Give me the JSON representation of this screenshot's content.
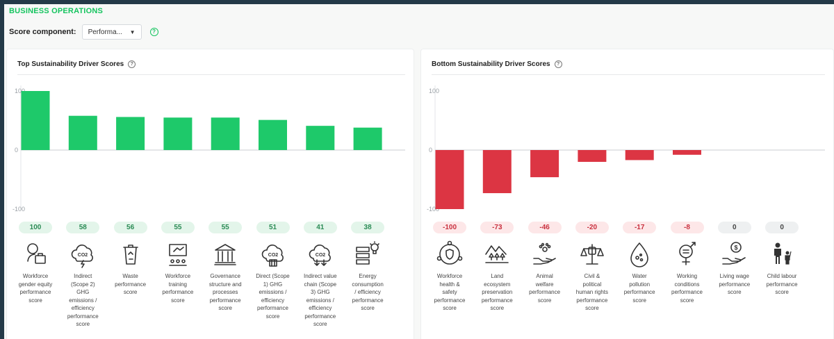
{
  "header": {
    "title": "BUSINESS OPERATIONS",
    "score_component_label": "Score component:",
    "score_component_value": "Performa...",
    "help_glyph": "?"
  },
  "colors": {
    "accent": "#14c45e",
    "positive": "#1ec96a",
    "negative": "#dc3543"
  },
  "chart_data": [
    {
      "type": "bar",
      "title": "Top Sustainability Driver Scores",
      "ylim": [
        -100,
        100
      ],
      "yticks": [
        100,
        0,
        -100
      ],
      "categories": [
        "Workforce gender equity performance score",
        "Indirect (Scope 2) GHG emissions / efficiency performance score",
        "Waste performance score",
        "Workforce training performance score",
        "Governance structure and processes performance score",
        "Direct (Scope 1) GHG emissions / efficiency performance score",
        "Indirect value chain (Scope 3) GHG emissions / efficiency performance score",
        "Energy consumption / efficiency performance score"
      ],
      "category_lines": [
        [
          "Workforce",
          "gender equity",
          "performance",
          "score"
        ],
        [
          "Indirect",
          "(Scope 2)",
          "GHG",
          "emissions /",
          "efficiency",
          "performance",
          "score"
        ],
        [
          "Waste",
          "performance",
          "score"
        ],
        [
          "Workforce",
          "training",
          "performance",
          "score"
        ],
        [
          "Governance",
          "structure and",
          "processes",
          "performance",
          "score"
        ],
        [
          "Direct (Scope",
          "1) GHG",
          "emissions /",
          "efficiency",
          "performance",
          "score"
        ],
        [
          "Indirect value",
          "chain (Scope",
          "3) GHG",
          "emissions /",
          "efficiency",
          "performance",
          "score"
        ],
        [
          "Energy",
          "consumption",
          "/ efficiency",
          "performance",
          "score"
        ]
      ],
      "icons": [
        "gender-equity-icon",
        "co2-cloud-lightning-icon",
        "recycle-bin-icon",
        "training-presentation-icon",
        "governance-building-icon",
        "co2-cloud-factory-icon",
        "co2-cloud-arrows-icon",
        "energy-battery-bulb-icon"
      ],
      "values": [
        100,
        58,
        56,
        55,
        55,
        51,
        41,
        38
      ]
    },
    {
      "type": "bar",
      "title": "Bottom Sustainability Driver Scores",
      "ylim": [
        -100,
        100
      ],
      "yticks": [
        100,
        0,
        -100
      ],
      "categories": [
        "Workforce health & safety performance score",
        "Land ecosystem preservation performance score",
        "Animal welfare performance score",
        "Civil & political human rights performance score",
        "Water pollution performance score",
        "Working conditions performance score",
        "Living wage performance score",
        "Child labour performance score"
      ],
      "category_lines": [
        [
          "Workforce",
          "health &",
          "safety",
          "performance",
          "score"
        ],
        [
          "Land",
          "ecosystem",
          "preservation",
          "performance",
          "score"
        ],
        [
          "Animal",
          "welfare",
          "performance",
          "score"
        ],
        [
          "Civil &",
          "political",
          "human rights",
          "performance",
          "score"
        ],
        [
          "Water",
          "pollution",
          "performance",
          "score"
        ],
        [
          "Working",
          "conditions",
          "performance",
          "score"
        ],
        [
          "Living wage",
          "performance",
          "score"
        ],
        [
          "Child labour",
          "performance",
          "score"
        ]
      ],
      "icons": [
        "health-safety-icon",
        "land-ecosystem-icon",
        "animal-welfare-icon",
        "human-rights-icon",
        "water-pollution-icon",
        "working-conditions-icon",
        "living-wage-icon",
        "child-labour-icon"
      ],
      "values": [
        -100,
        -73,
        -46,
        -20,
        -17,
        -8,
        0,
        0
      ]
    }
  ]
}
